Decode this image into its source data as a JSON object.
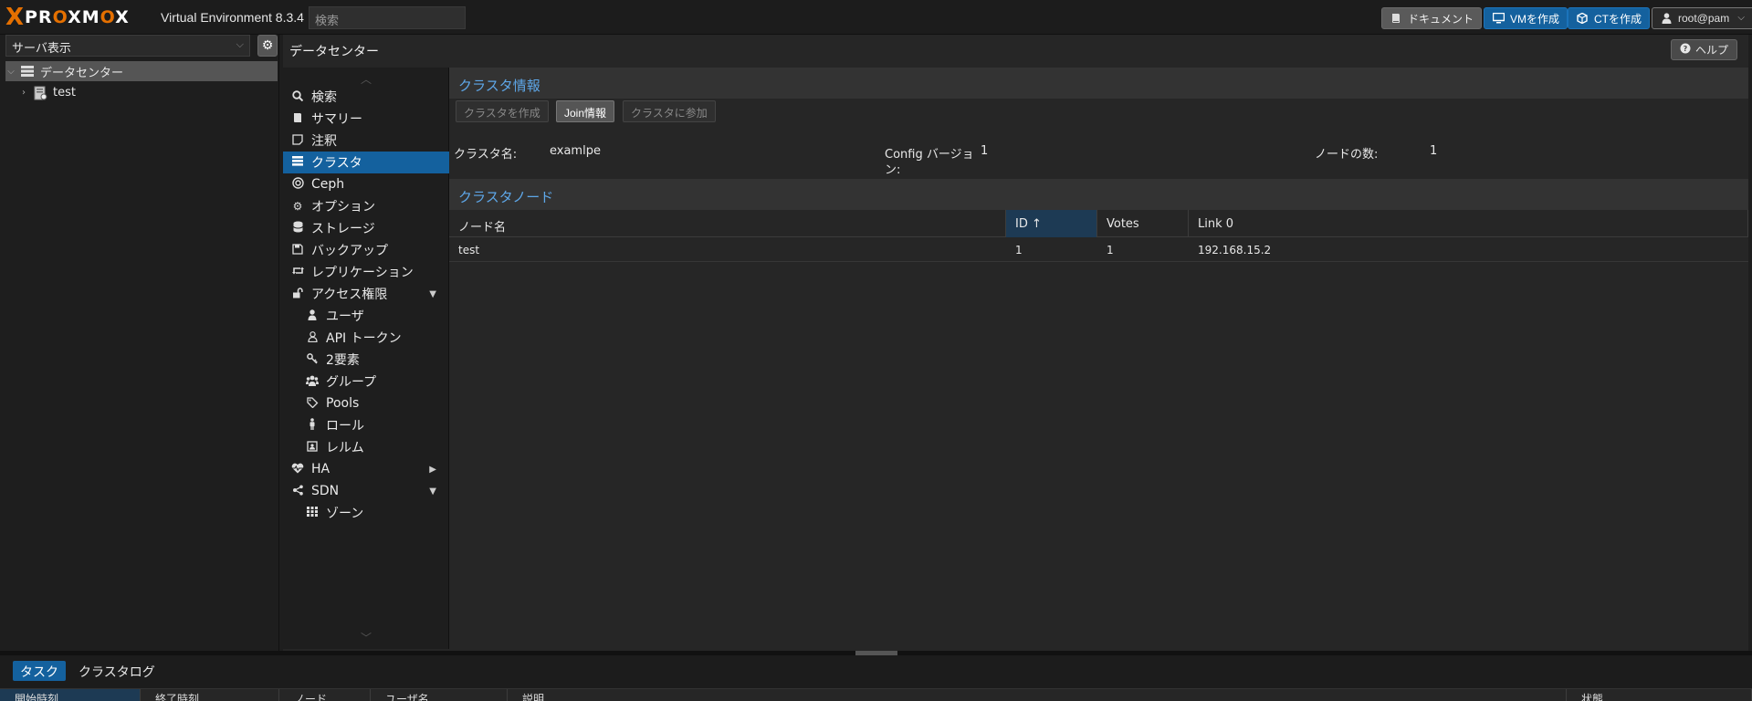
{
  "header": {
    "logo_x": "X",
    "logo_text_1": "PR",
    "logo_text_o": "O",
    "logo_text_2": "XM",
    "logo_text_o2": "O",
    "logo_text_3": "X",
    "version": "Virtual Environment 8.3.4",
    "search_placeholder": "検索",
    "docs_label": "ドキュメント",
    "create_vm_label": "VMを作成",
    "create_ct_label": "CTを作成",
    "user_label": "root@pam"
  },
  "resource_tree": {
    "view_label": "サーバ表示",
    "items": [
      {
        "label": "データセンター",
        "icon": "datacenter-icon",
        "selected": true
      },
      {
        "label": "test",
        "icon": "server-icon",
        "selected": false
      }
    ]
  },
  "content": {
    "title": "データセンター",
    "help_label": "ヘルプ"
  },
  "menu": {
    "items": [
      {
        "label": "検索",
        "icon": "search-icon"
      },
      {
        "label": "サマリー",
        "icon": "book-icon"
      },
      {
        "label": "注釈",
        "icon": "note-icon"
      },
      {
        "label": "クラスタ",
        "icon": "cluster-icon",
        "selected": true
      },
      {
        "label": "Ceph",
        "icon": "ceph-icon"
      },
      {
        "label": "オプション",
        "icon": "gear-icon"
      },
      {
        "label": "ストレージ",
        "icon": "database-icon"
      },
      {
        "label": "バックアップ",
        "icon": "floppy-icon"
      },
      {
        "label": "レプリケーション",
        "icon": "retweet-icon"
      },
      {
        "label": "アクセス権限",
        "icon": "unlock-icon",
        "expanded": true
      },
      {
        "label": "ユーザ",
        "icon": "user-icon",
        "sub": true
      },
      {
        "label": "API トークン",
        "icon": "user-outline-icon",
        "sub": true
      },
      {
        "label": "2要素",
        "icon": "key-icon",
        "sub": true
      },
      {
        "label": "グループ",
        "icon": "users-icon",
        "sub": true
      },
      {
        "label": "Pools",
        "icon": "tags-icon",
        "sub": true
      },
      {
        "label": "ロール",
        "icon": "male-icon",
        "sub": true
      },
      {
        "label": "レルム",
        "icon": "id-card-icon",
        "sub": true
      },
      {
        "label": "HA",
        "icon": "heartbeat-icon",
        "collapsed": true
      },
      {
        "label": "SDN",
        "icon": "sdn-icon",
        "expanded": true
      },
      {
        "label": "ゾーン",
        "icon": "grid-icon",
        "sub": true
      }
    ]
  },
  "cluster_info": {
    "title": "クラスタ情報",
    "create_button": "クラスタを作成",
    "join_info_button": "Join情報",
    "join_button": "クラスタに参加",
    "name_label": "クラスタ名:",
    "name_value": "examlpe",
    "config_label_1": "Config バージョ",
    "config_label_2": "ン:",
    "config_value": "1",
    "nodes_label": "ノードの数:",
    "nodes_value": "1"
  },
  "cluster_nodes": {
    "title": "クラスタノード",
    "columns": [
      "ノード名",
      "ID ↑",
      "Votes",
      "Link 0"
    ],
    "rows": [
      {
        "name": "test",
        "id": "1",
        "votes": "1",
        "link0": "192.168.15.2"
      }
    ]
  },
  "log_panel": {
    "tabs": [
      "タスク",
      "クラスタログ"
    ],
    "active_tab": 0,
    "columns": [
      "開始時刻",
      "終了時刻",
      "ノード",
      "ユーザ名",
      "説明",
      "状態"
    ]
  },
  "colors": {
    "accent_blue": "#14619e",
    "title_blue": "#5ea7e8",
    "logo_orange": "#e57000"
  }
}
